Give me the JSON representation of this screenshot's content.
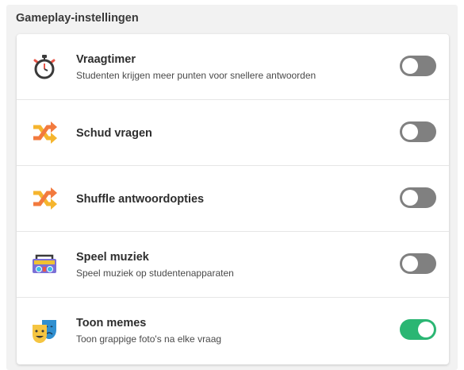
{
  "section": {
    "title": "Gameplay-instellingen"
  },
  "settings": [
    {
      "title": "Vraagtimer",
      "description": "Studenten krijgen meer punten voor snellere antwoorden",
      "enabled": false,
      "icon": "stopwatch-icon"
    },
    {
      "title": "Schud vragen",
      "description": "",
      "enabled": false,
      "icon": "shuffle-icon"
    },
    {
      "title": "Shuffle antwoordopties",
      "description": "",
      "enabled": false,
      "icon": "shuffle-icon"
    },
    {
      "title": "Speel muziek",
      "description": "Speel muziek op studentenapparaten",
      "enabled": false,
      "icon": "boombox-icon"
    },
    {
      "title": "Toon memes",
      "description": "Toon grappige foto's na elke vraag",
      "enabled": true,
      "icon": "theater-masks-icon"
    }
  ],
  "colors": {
    "toggle_off": "#808080",
    "toggle_on": "#2bb673"
  }
}
